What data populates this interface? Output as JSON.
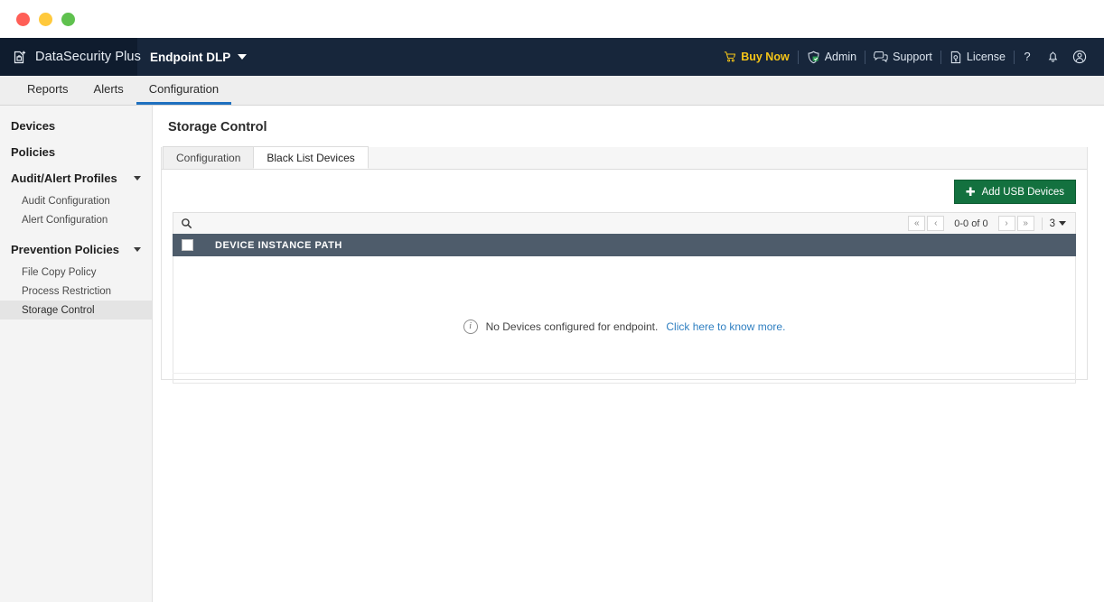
{
  "window": {
    "traffic_lights": [
      "close",
      "minimize",
      "zoom"
    ],
    "colors": {
      "close": "#ff5f57",
      "minimize": "#ffc93c",
      "zoom": "#5fc14e"
    }
  },
  "header": {
    "brand": "DataSecurity Plus",
    "brand_icon": "document-lock-plus-icon",
    "product": "Endpoint DLP",
    "product_caret_icon": "chevron-down-icon",
    "background": "#17263b",
    "right_items": [
      {
        "label": "Buy Now",
        "icon": "shopping-cart-icon",
        "color": "#f5c518"
      },
      {
        "label": "Admin",
        "icon": "admin-shield-icon",
        "color": "#dce5ef"
      },
      {
        "label": "Support",
        "icon": "support-chat-icon",
        "color": "#dce5ef"
      },
      {
        "label": "License",
        "icon": "license-key-icon",
        "color": "#dce5ef"
      }
    ],
    "icon_only_items": [
      {
        "icon": "help-question-icon",
        "glyph": "?"
      },
      {
        "icon": "notification-bell-icon",
        "glyph": "○"
      },
      {
        "icon": "user-account-icon",
        "glyph": "○"
      }
    ]
  },
  "nav": {
    "tabs": [
      {
        "label": "Reports",
        "active": false
      },
      {
        "label": "Alerts",
        "active": false
      },
      {
        "label": "Configuration",
        "active": true
      }
    ],
    "active_underline_color": "#1e70bf"
  },
  "sidebar": {
    "entries": [
      {
        "type": "group",
        "label": "Devices",
        "expandable": false
      },
      {
        "type": "group",
        "label": "Policies",
        "expandable": false
      },
      {
        "type": "group",
        "label": "Audit/Alert Profiles",
        "expandable": true
      },
      {
        "type": "item",
        "label": "Audit Configuration",
        "active": false
      },
      {
        "type": "item",
        "label": "Alert Configuration",
        "active": false
      },
      {
        "type": "group",
        "label": "Prevention Policies",
        "expandable": true
      },
      {
        "type": "item",
        "label": "File Copy Policy",
        "active": false
      },
      {
        "type": "item",
        "label": "Process Restriction",
        "active": false
      },
      {
        "type": "item",
        "label": "Storage Control",
        "active": true
      }
    ]
  },
  "main": {
    "page_title": "Storage Control",
    "panel_tabs": [
      {
        "label": "Configuration",
        "active": false
      },
      {
        "label": "Black List Devices",
        "active": true
      }
    ],
    "add_button": {
      "label": "Add USB Devices",
      "icon": "plus-icon",
      "glyph": "✚",
      "color": "#13713f"
    },
    "toolbar": {
      "search_icon": "search-icon",
      "pager": {
        "first_glyph": "«",
        "prev_glyph": "‹",
        "next_glyph": "›",
        "last_glyph": "»",
        "count_text": "0-0 of 0",
        "page_size": "3",
        "page_size_caret_icon": "chevron-down-icon"
      }
    },
    "grid": {
      "header_background": "#4e5c6b",
      "select_all_checkbox": "select-all-checkbox",
      "columns": [
        "DEVICE INSTANCE PATH"
      ],
      "rows": [],
      "empty_state": {
        "icon": "info-icon",
        "glyph": "i",
        "message": "No Devices configured for endpoint.",
        "link_text": "Click here to know more.",
        "link_color": "#2f7fc1"
      }
    }
  }
}
